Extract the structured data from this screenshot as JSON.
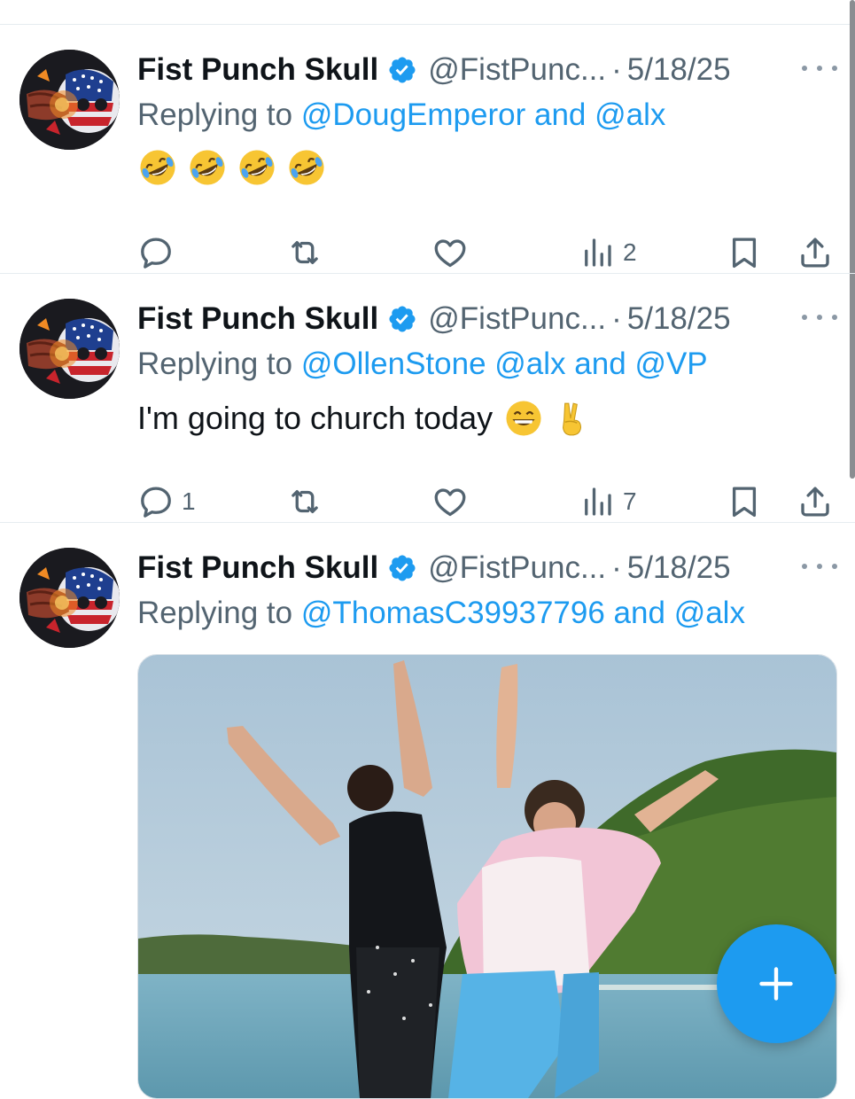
{
  "tweets": [
    {
      "name": "Fist Punch Skull",
      "handle": "@FistPunc...",
      "sep": "·",
      "date": "5/18/25",
      "reply_prefix": "Replying to",
      "mentions": [
        "@DougEmperor",
        "and",
        "@alx"
      ],
      "text": "",
      "emojis": [
        "rofl",
        "rofl",
        "rofl",
        "rofl"
      ],
      "reply_count": "",
      "views": "2"
    },
    {
      "name": "Fist Punch Skull",
      "handle": "@FistPunc...",
      "sep": "·",
      "date": "5/18/25",
      "reply_prefix": "Replying to",
      "mentions": [
        "@OllenStone",
        "@alx",
        "and",
        "@VP"
      ],
      "text": "I'm going to church today",
      "emojis": [
        "grin",
        "victory-hand"
      ],
      "reply_count": "1",
      "views": "7"
    },
    {
      "name": "Fist Punch Skull",
      "handle": "@FistPunc...",
      "sep": "·",
      "date": "5/18/25",
      "reply_prefix": "Replying to",
      "mentions": [
        "@ThomasC39937796",
        "and",
        "@alx"
      ],
      "media": "beach-dance-photo"
    }
  ],
  "icons": {
    "reply": "speech-bubble-icon",
    "retweet": "retweet-icon",
    "like": "heart-icon",
    "views": "bar-chart-icon",
    "bookmark": "bookmark-icon",
    "share": "share-icon",
    "compose": "plus-icon"
  },
  "colors": {
    "accent": "#1d9bf0",
    "muted": "#536471",
    "text": "#0f1419"
  }
}
